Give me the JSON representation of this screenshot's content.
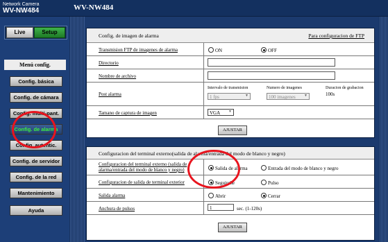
{
  "header": {
    "brand_line1": "Network Camera",
    "brand_line2": "WV-NW484",
    "model": "WV-NW484"
  },
  "mode": {
    "live": "Live",
    "setup": "Setup"
  },
  "menu": {
    "title": "Menú config.",
    "items": [
      "Config. básica",
      "Config. de cámara",
      "Config. multi-pant.",
      "Config. de alarma",
      "Config. autentic.",
      "Config. de servidor",
      "Config. de la red",
      "Mantenimiento",
      "Ayuda"
    ]
  },
  "alarm_image": {
    "title": "Config. de imagen de alarma",
    "ftp_link": "Para configuracion de FTP",
    "ftp_label": "Transmision FTP de imagenes de alarma",
    "on": "ON",
    "off": "OFF",
    "directory_label": "Directorio",
    "filename_label": "Nombre de archivo",
    "post_label": "Post alarma",
    "interval_label": "Intervalo de transmision",
    "interval_value": "1 fps",
    "count_label": "Numero de imagenes",
    "count_value": "100 imagenes",
    "duration_label": "Duracion de grabacion",
    "duration_value": "100s",
    "size_label": "Tamano de captura de imagen",
    "size_value": "VGA",
    "submit": "AJUSTAR"
  },
  "terminal": {
    "title": "Configuracion del terminal externo(salida de alarma/entrada del modo de blanco y negro)",
    "cfg_label_1": "Configuracion del terminal externo (salida de",
    "cfg_label_2": "alarma/entrada del modo de blanco y negro)",
    "opt_alarm": "Salida de alarma",
    "opt_bw": "Entrada del modo de blanco y negro",
    "out_label": "Configuracion de salida de terminal exterior",
    "opt_latch": "Seguirche",
    "opt_pulse": "Pulso",
    "alarm_out_label": "Salida alarma",
    "opt_open": "Abrir",
    "opt_close": "Cerrar",
    "pulse_label": "Anchura de pulsos",
    "pulse_value": "1",
    "pulse_unit": "sec. (1-120s)",
    "submit": "AJUSTAR"
  },
  "colors": {
    "accent_green": "#3cf040",
    "annotation_red": "#e8141e"
  }
}
